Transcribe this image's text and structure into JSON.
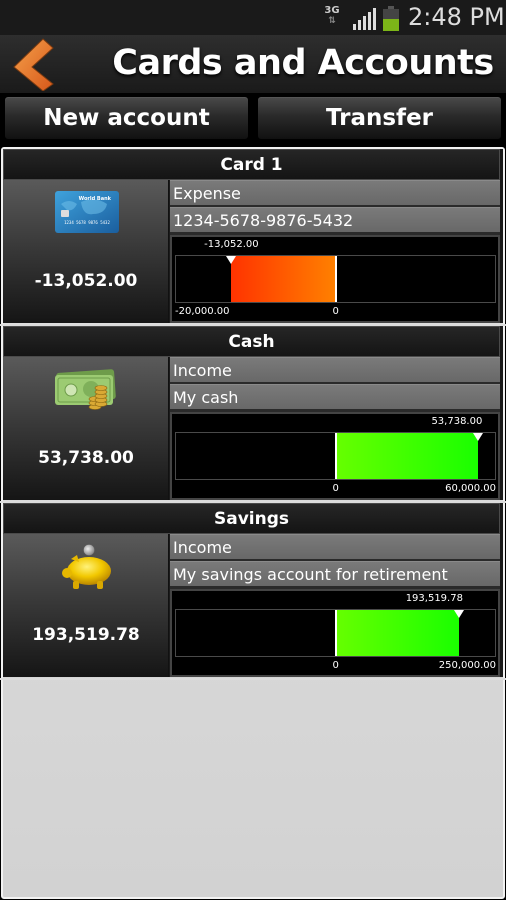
{
  "status_bar": {
    "network": "3G",
    "network_arrows": "⇅",
    "time": "2:48 PM",
    "battery_color": "#7cb518"
  },
  "header": {
    "title": "Cards and Accounts",
    "back_icon": "chevron-left-icon",
    "accent_color": "#e8742a"
  },
  "toolbar": {
    "new_account_label": "New account",
    "transfer_label": "Transfer"
  },
  "accounts": [
    {
      "name": "Card 1",
      "icon": "credit-card-icon",
      "icon_text": "World Bank",
      "balance": "-13,052.00",
      "type": "Expense",
      "description": "1234-5678-9876-5432",
      "gauge": {
        "value": -13052.0,
        "value_label": "-13,052.00",
        "range_min_label": "-20,000.00",
        "range_max_label": "",
        "zero_label": "0",
        "scale": 20000,
        "fill_from": "#ff3300",
        "fill_to": "#ff8000"
      }
    },
    {
      "name": "Cash",
      "icon": "cash-icon",
      "balance": "53,738.00",
      "type": "Income",
      "description": "My cash",
      "gauge": {
        "value": 53738.0,
        "value_label": "53,738.00",
        "range_min_label": "",
        "range_max_label": "60,000.00",
        "zero_label": "0",
        "scale": 60000,
        "fill_from": "#66ff00",
        "fill_to": "#1aff00"
      }
    },
    {
      "name": "Savings",
      "icon": "piggy-bank-icon",
      "balance": "193,519.78",
      "type": "Income",
      "description": "My savings account for retirement",
      "gauge": {
        "value": 193519.78,
        "value_label": "193,519.78",
        "range_min_label": "",
        "range_max_label": "250,000.00",
        "zero_label": "0",
        "scale": 250000,
        "fill_from": "#66ff00",
        "fill_to": "#1aff00"
      }
    }
  ]
}
